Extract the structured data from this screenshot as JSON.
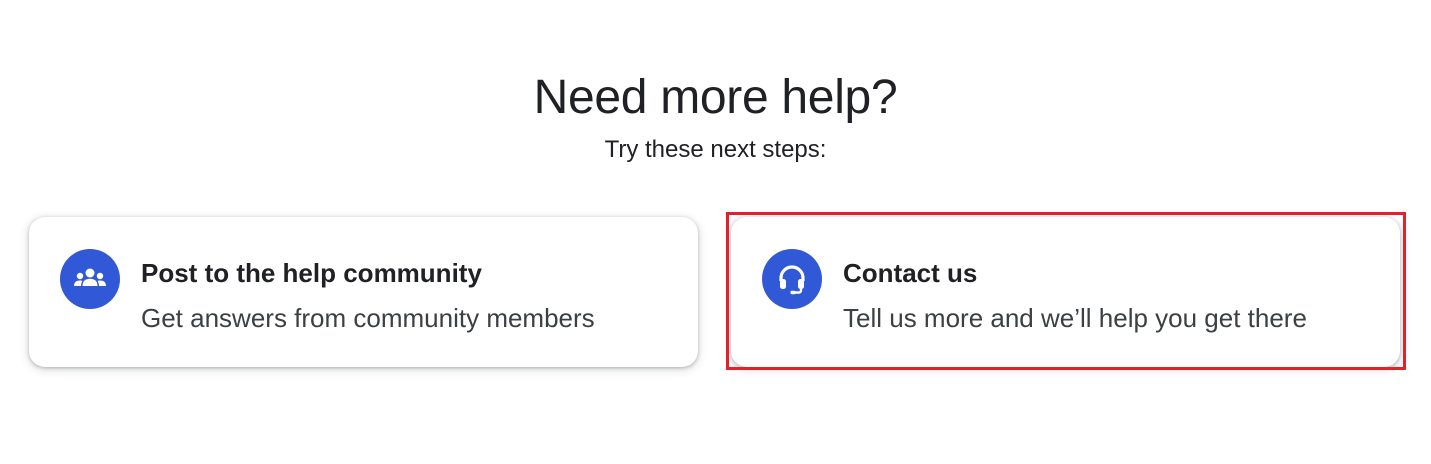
{
  "header": {
    "title": "Need more help?",
    "subtitle": "Try these next steps:"
  },
  "cards": [
    {
      "title": "Post to the help community",
      "description": "Get answers from community members",
      "icon": "community-icon"
    },
    {
      "title": "Contact us",
      "description": "Tell us more and we’ll help you get there",
      "icon": "headset-icon"
    }
  ],
  "colors": {
    "icon_background": "#3158d6",
    "highlight_border": "#e3202c",
    "text_primary": "#202124"
  }
}
